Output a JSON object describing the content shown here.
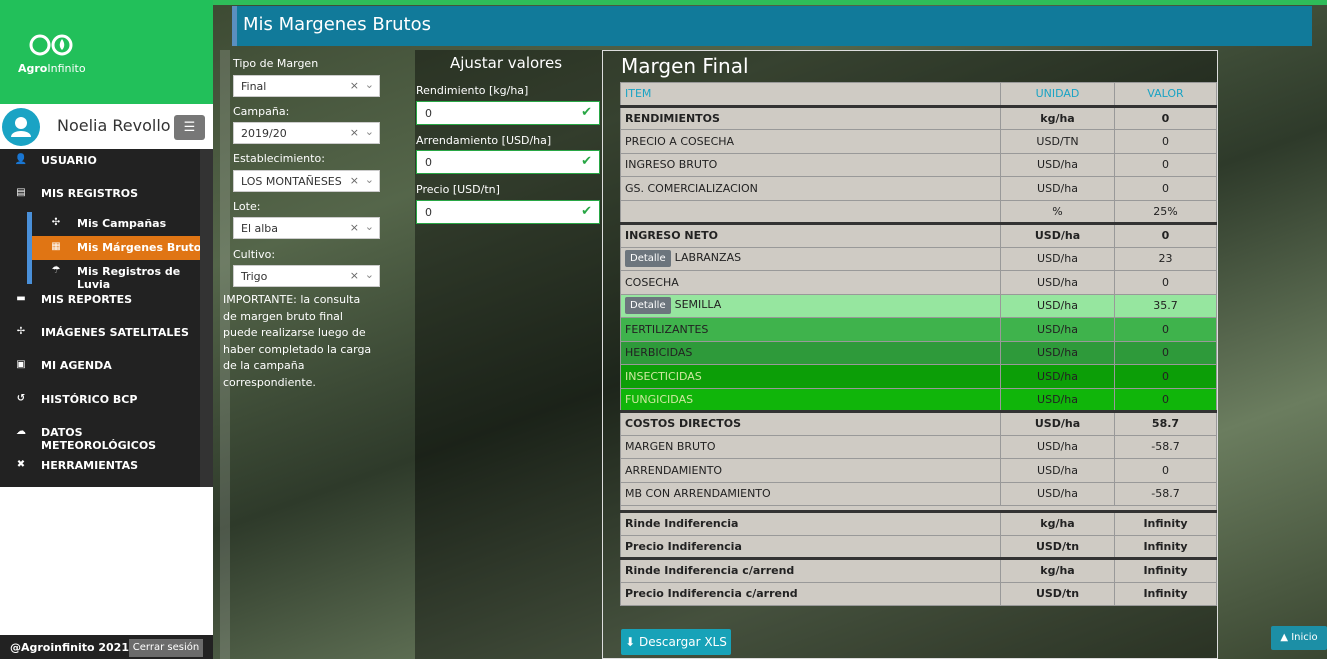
{
  "brand": {
    "name_bold": "Agro",
    "name_light": "Infinito"
  },
  "user": {
    "name": "Noelia Revollo",
    "menu_toggle": "☰"
  },
  "nav": [
    {
      "icon": "user-icon",
      "label": "USUARIO"
    },
    {
      "icon": "file-icon",
      "label": "MIS REGISTROS"
    },
    {
      "icon": "folder-icon",
      "label": "MIS REPORTES"
    },
    {
      "icon": "satellite-icon",
      "label": "IMÁGENES SATELITALES"
    },
    {
      "icon": "calendar-icon",
      "label": "MI AGENDA"
    },
    {
      "icon": "history-icon",
      "label": "HISTÓRICO BCP"
    },
    {
      "icon": "cloud-icon",
      "label": "DATOS METEOROLÓGICOS"
    },
    {
      "icon": "tools-icon",
      "label": "HERRAMIENTAS"
    }
  ],
  "subnav": [
    {
      "icon": "sprout-icon",
      "label": "Mis Campañas"
    },
    {
      "icon": "document-icon",
      "label": "Mis Márgenes Brutos"
    },
    {
      "icon": "rain-icon",
      "label": "Mis Registros de Luvia"
    }
  ],
  "footer": {
    "copyright": "@Agroinfinito 2021",
    "logout": "Cerrar sesión"
  },
  "page": {
    "title": "Mis Margenes Brutos"
  },
  "filters": [
    {
      "label": "Tipo de Margen",
      "value": "Final"
    },
    {
      "label": "Campaña:",
      "value": "2019/20"
    },
    {
      "label": "Establecimiento:",
      "value": "LOS MONTAÑESES"
    },
    {
      "label": "Lote:",
      "value": "El alba"
    },
    {
      "label": "Cultivo:",
      "value": "Trigo"
    }
  ],
  "filter_clear": "×",
  "filter_arrow": "⌄",
  "note": "IMPORTANTE: la consulta de margen bruto final puede realizarse luego de haber completado la carga de la campaña correspondiente.",
  "adjust": {
    "title": "Ajustar valores",
    "fields": [
      {
        "label": "Rendimiento [kg/ha]",
        "value": "0"
      },
      {
        "label": "Arrendamiento [USD/ha]",
        "value": "0"
      },
      {
        "label": "Precio [USD/tn]",
        "value": "0"
      }
    ],
    "check": "✔"
  },
  "result": {
    "title": "Margen Final",
    "headers": [
      "ITEM",
      "UNIDAD",
      "VALOR"
    ],
    "detail_label": "Detalle",
    "rows": [
      {
        "item": "RENDIMIENTOS",
        "unit": "kg/ha",
        "value": "0"
      },
      {
        "item": "PRECIO A COSECHA",
        "unit": "USD/TN",
        "value": "0"
      },
      {
        "item": "INGRESO BRUTO",
        "unit": "USD/ha",
        "value": "0"
      },
      {
        "item": "GS. COMERCIALIZACION",
        "unit": "USD/ha",
        "value": "0"
      },
      {
        "item": "",
        "unit": "%",
        "value": "25%"
      },
      {
        "item": "INGRESO NETO",
        "unit": "USD/ha",
        "value": "0"
      },
      {
        "item": "LABRANZAS",
        "unit": "USD/ha",
        "value": "23"
      },
      {
        "item": "COSECHA",
        "unit": "USD/ha",
        "value": "0"
      },
      {
        "item": "SEMILLA",
        "unit": "USD/ha",
        "value": "35.7"
      },
      {
        "item": "FERTILIZANTES",
        "unit": "USD/ha",
        "value": "0"
      },
      {
        "item": "HERBICIDAS",
        "unit": "USD/ha",
        "value": "0"
      },
      {
        "item": "INSECTICIDAS",
        "unit": "USD/ha",
        "value": "0"
      },
      {
        "item": "FUNGICIDAS",
        "unit": "USD/ha",
        "value": "0"
      },
      {
        "item": "COSTOS DIRECTOS",
        "unit": "USD/ha",
        "value": "58.7"
      },
      {
        "item": "MARGEN BRUTO",
        "unit": "USD/ha",
        "value": "-58.7"
      },
      {
        "item": "ARRENDAMIENTO",
        "unit": "USD/ha",
        "value": "0"
      },
      {
        "item": "MB CON ARRENDAMIENTO",
        "unit": "USD/ha",
        "value": "-58.7"
      },
      {
        "item": "Rinde Indiferencia",
        "unit": "kg/ha",
        "value": "Infinity"
      },
      {
        "item": "Precio Indiferencia",
        "unit": "USD/tn",
        "value": "Infinity"
      },
      {
        "item": "Rinde Indiferencia c/arrend",
        "unit": "kg/ha",
        "value": "Infinity"
      },
      {
        "item": "Precio Indiferencia c/arrend",
        "unit": "USD/tn",
        "value": "Infinity"
      }
    ],
    "download": "Descargar XLS"
  },
  "top_button": "Inicio"
}
